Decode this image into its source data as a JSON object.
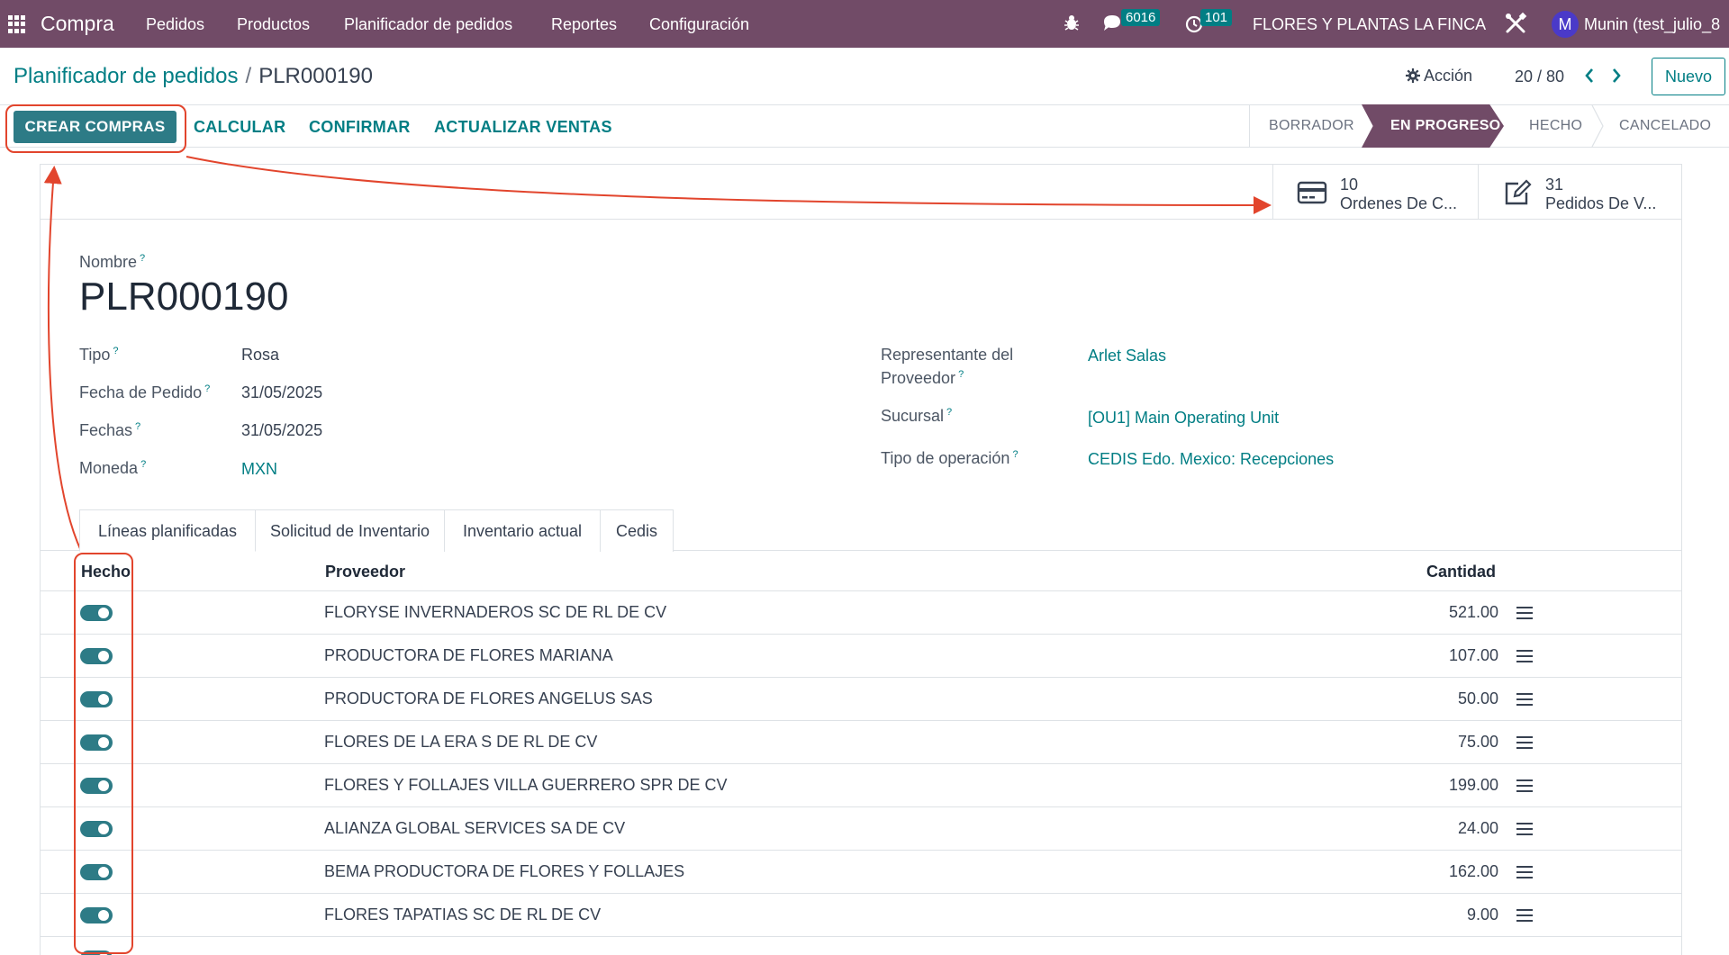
{
  "navbar": {
    "app_name": "Compra",
    "menu": [
      "Pedidos",
      "Productos",
      "Planificador de pedidos",
      "Reportes",
      "Configuración"
    ],
    "messages_badge": "6016",
    "activities_badge": "101",
    "company": "FLORES Y PLANTAS LA FINCA",
    "user_initial": "M",
    "user_name": "Munin (test_julio_8"
  },
  "control_panel": {
    "breadcrumb_parent": "Planificador de pedidos",
    "breadcrumb_sep": "/",
    "breadcrumb_current": "PLR000190",
    "action_label": "Acción",
    "pager": "20 / 80",
    "new_label": "Nuevo"
  },
  "statusbar": {
    "buttons": [
      "CREAR COMPRAS",
      "CALCULAR",
      "CONFIRMAR",
      "ACTUALIZAR VENTAS"
    ],
    "stages": [
      "BORRADOR",
      "EN PROGRESO",
      "HECHO",
      "CANCELADO"
    ],
    "active_stage": "EN PROGRESO"
  },
  "smart_buttons": [
    {
      "count": "10",
      "label": "Ordenes De C...",
      "icon": "credit-card-icon"
    },
    {
      "count": "31",
      "label": "Pedidos De V...",
      "icon": "edit-icon"
    }
  ],
  "form": {
    "name_label": "Nombre",
    "name_value": "PLR000190",
    "left": [
      {
        "label": "Tipo",
        "value": "Rosa"
      },
      {
        "label": "Fecha de Pedido",
        "value": "31/05/2025"
      },
      {
        "label": "Fechas",
        "value": "31/05/2025"
      },
      {
        "label": "Moneda",
        "value": "MXN"
      }
    ],
    "right": [
      {
        "label_line1": "Representante del",
        "label_line2": "Proveedor",
        "value": "Arlet Salas"
      },
      {
        "label": "Sucursal",
        "value": "[OU1] Main Operating Unit"
      },
      {
        "label": "Tipo de operación",
        "value": "CEDIS Edo. Mexico: Recepciones"
      }
    ],
    "help_mark": "?"
  },
  "tabs": [
    "Líneas planificadas",
    "Solicitud de Inventario",
    "Inventario actual",
    "Cedis"
  ],
  "list": {
    "headers": {
      "done": "Hecho",
      "supplier": "Proveedor",
      "quantity": "Cantidad"
    },
    "rows": [
      {
        "done": true,
        "supplier": "FLORYSE INVERNADEROS SC DE RL DE CV",
        "quantity": "521.00"
      },
      {
        "done": true,
        "supplier": "PRODUCTORA DE FLORES MARIANA",
        "quantity": "107.00"
      },
      {
        "done": true,
        "supplier": "PRODUCTORA DE FLORES ANGELUS SAS",
        "quantity": "50.00"
      },
      {
        "done": true,
        "supplier": "FLORES DE LA ERA S DE RL DE CV",
        "quantity": "75.00"
      },
      {
        "done": true,
        "supplier": "FLORES Y FOLLAJES VILLA GUERRERO SPR DE CV",
        "quantity": "199.00"
      },
      {
        "done": true,
        "supplier": "ALIANZA GLOBAL SERVICES SA DE CV",
        "quantity": "24.00"
      },
      {
        "done": true,
        "supplier": "BEMA PRODUCTORA DE FLORES Y FOLLAJES",
        "quantity": "162.00"
      },
      {
        "done": true,
        "supplier": "FLORES TAPATIAS SC DE RL DE CV",
        "quantity": "9.00"
      }
    ]
  },
  "colors": {
    "brand": "#714b67",
    "accent": "#017e84",
    "toggle_on": "#2d7b86",
    "annotation": "#e2452d"
  }
}
